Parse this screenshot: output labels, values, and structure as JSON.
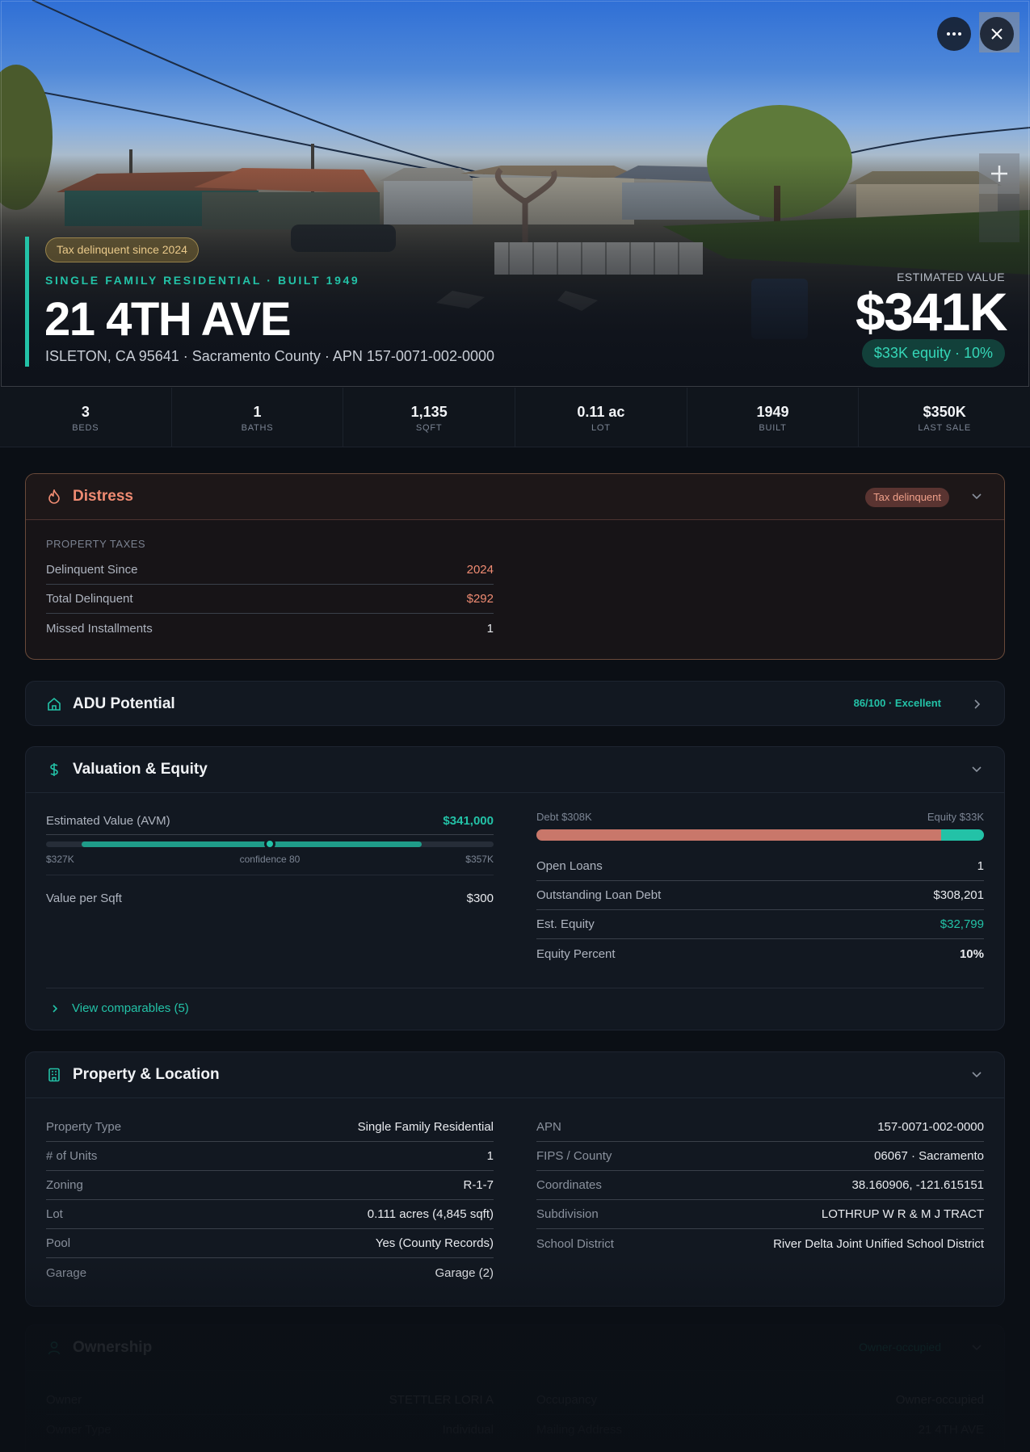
{
  "hero": {
    "tag": "Tax delinquent since 2024",
    "kicker": "SINGLE FAMILY RESIDENTIAL · BUILT 1949",
    "title": "21 4TH AVE",
    "subtitle": "ISLETON, CA 95641 · Sacramento County · APN 157-0071-002-0000",
    "est_label": "ESTIMATED VALUE",
    "est_value": "$341K",
    "equity_pill": "$33K equity · 10%"
  },
  "icons": {
    "more": "more-horizontal-icon",
    "close": "close-icon",
    "zoom": "plus-icon"
  },
  "stats": [
    {
      "value": "3",
      "label": "BEDS"
    },
    {
      "value": "1",
      "label": "BATHS"
    },
    {
      "value": "1,135",
      "label": "SQFT"
    },
    {
      "value": "0.11 ac",
      "label": "LOT"
    },
    {
      "value": "1949",
      "label": "BUILT"
    },
    {
      "value": "$350K",
      "label": "LAST SALE"
    }
  ],
  "distress": {
    "title": "Distress",
    "pill": "Tax delinquent",
    "section": "PROPERTY TAXES",
    "rows": [
      {
        "k": "Delinquent Since",
        "v": "2024"
      },
      {
        "k": "Total Delinquent",
        "v": "$292"
      },
      {
        "k": "Missed Installments",
        "v": "1"
      }
    ]
  },
  "adu": {
    "title": "ADU Potential",
    "score": "86/100 · Excellent"
  },
  "valuation": {
    "title": "Valuation & Equity",
    "avm_label": "Estimated Value (AVM)",
    "avm_value": "$341,000",
    "range_low": "$327K",
    "confidence": "confidence 80",
    "range_high": "$357K",
    "avm_position": 0.5,
    "vps_label": "Value per Sqft",
    "vps_value": "$300",
    "debt_label": "Debt $308K",
    "equity_label": "Equity $33K",
    "debt_fraction": 0.904,
    "rows": [
      {
        "k": "Open Loans",
        "v": "1"
      },
      {
        "k": "Outstanding Loan Debt",
        "v": "$308,201"
      },
      {
        "k": "Est. Equity",
        "v": "$32,799"
      },
      {
        "k": "Equity Percent",
        "v": "10%"
      }
    ],
    "comparables": "View comparables (5)"
  },
  "property": {
    "title": "Property & Location",
    "left": [
      {
        "k": "Property Type",
        "v": "Single Family Residential"
      },
      {
        "k": "# of Units",
        "v": "1"
      },
      {
        "k": "Zoning",
        "v": "R-1-7"
      },
      {
        "k": "Lot",
        "v": "0.111 acres (4,845 sqft)"
      },
      {
        "k": "Pool",
        "v": "Yes (County Records)"
      },
      {
        "k": "Garage",
        "v": "Garage (2)"
      }
    ],
    "right": [
      {
        "k": "APN",
        "v": "157-0071-002-0000"
      },
      {
        "k": "FIPS / County",
        "v": "06067 · Sacramento"
      },
      {
        "k": "Coordinates",
        "v": "38.160906, -121.615151"
      },
      {
        "k": "Subdivision",
        "v": "LOTHRUP W R & M J TRACT"
      },
      {
        "k": "School District",
        "v": "River Delta Joint Unified School District"
      }
    ]
  },
  "ownership": {
    "title": "Ownership",
    "pill": "Owner-occupied",
    "left": [
      {
        "k": "Owner",
        "v": "STETTLER LORI A"
      },
      {
        "k": "Owner Type",
        "v": "Individual"
      }
    ],
    "right": [
      {
        "k": "Occupancy",
        "v": "Owner-occupied"
      },
      {
        "k": "Mailing Address",
        "v": "21 4TH AVE"
      }
    ]
  },
  "colors": {
    "accent": "#23c2a7",
    "debt": "#c9776a",
    "distress": "#ef8b72"
  }
}
